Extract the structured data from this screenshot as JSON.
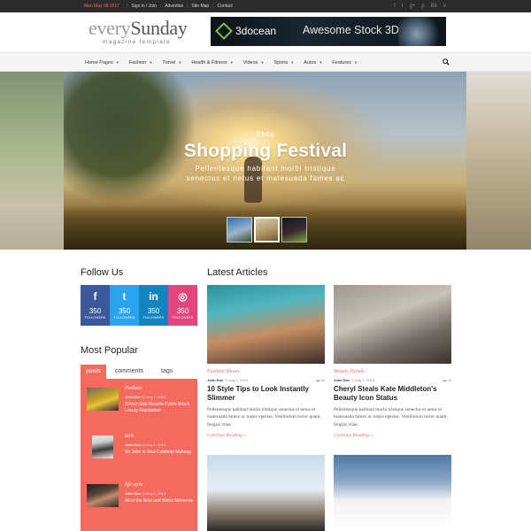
{
  "topbar": {
    "date": "Mon May 08 2017",
    "links": [
      "Sign in / Join",
      "Advertise",
      "Site Map",
      "Contact"
    ],
    "social_icons": [
      "f",
      "t",
      "g+",
      "p",
      "Bē",
      "v"
    ]
  },
  "logo": {
    "part1": "every",
    "part2": "Sunday",
    "tagline": "magazine template"
  },
  "banner": {
    "brand": "3docean",
    "tagline": "Awesome Stock 3D"
  },
  "nav": {
    "items": [
      "Home Pages",
      "Fashion",
      "Travel",
      "Health & Fitness",
      "Videos",
      "Sports",
      "Autos",
      "Features"
    ]
  },
  "hero": {
    "kicker": "Shop",
    "title": "Shopping Festival",
    "subtitle_line1": "Pellentesque habitant morbi tristique",
    "subtitle_line2": "senectus et netus et malesuada fames ac"
  },
  "follow": {
    "title": "Follow Us",
    "boxes": [
      {
        "icon": "f",
        "count": "350",
        "label": "FOLLOWERS"
      },
      {
        "icon": "t",
        "count": "350",
        "label": "FOLLOWERS"
      },
      {
        "icon": "in",
        "count": "350",
        "label": "FOLLOWERS"
      },
      {
        "icon": "◎",
        "count": "350",
        "label": "FOLLOWERS"
      }
    ]
  },
  "popular": {
    "title": "Most Popular",
    "tabs": [
      "posts",
      "comments",
      "tags"
    ],
    "items": [
      {
        "category": "Fashion",
        "author": "John Doe",
        "date": "may 1, 2015",
        "title": "3 Four-Star Resorts Costa Rica's Luxury Reputation"
      },
      {
        "category": "tech",
        "author": "John Doe",
        "date": "may 1, 2015",
        "title": "Sir John is New Celebrity Makeup"
      },
      {
        "category": "life style",
        "author": "John Doe",
        "date": "may 1, 2015",
        "title": "All of the Best and Worst Moments"
      }
    ]
  },
  "latest": {
    "title": "Latest Articles",
    "articles": [
      {
        "category": "Fashion Shows",
        "author": "John Doe",
        "date": "may 1, 2015",
        "comments": "20",
        "title": "10 Style Tips to Look Instantly Slimmer",
        "excerpt": "Pellentesque habitant morbi tristique senectus et netus et malesuada fames ac turpis egestas. Vestibulum tortor quam, feugiat vitae.",
        "more": "Continue Reading »"
      },
      {
        "category": "Beauty Trends",
        "author": "John Doe",
        "date": "may 1, 2015",
        "comments": "20",
        "title": "Cheryl Steals Kate Middleton's Beauty Icon Status",
        "excerpt": "Pellentesque habitant morbi tristique senectus et netus et malesuada fames ac turpis egestas. Vestibulum tortor quam, feugiat vitae.",
        "more": "Continue Reading »"
      }
    ]
  },
  "colors": {
    "accent": "#f46a5e",
    "facebook": "#3b5998",
    "twitter": "#2aa3ef",
    "linkedin": "#1384be",
    "dribbble": "#e2467c",
    "topbar": "#2b2b2b"
  }
}
